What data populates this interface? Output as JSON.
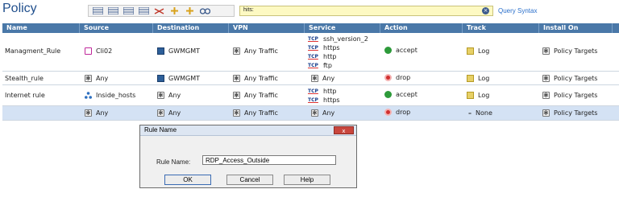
{
  "page_title": "Policy",
  "search": {
    "value": "hits:",
    "clear_icon": "clear-icon"
  },
  "query_syntax": "Query Syntax",
  "columns": [
    "Name",
    "Source",
    "Destination",
    "VPN",
    "Service",
    "Action",
    "Track",
    "Install On"
  ],
  "rows": [
    {
      "name": "Managment_Rule",
      "source": "Cli02",
      "destination": "GWMGMT",
      "vpn": "Any Traffic",
      "services": [
        {
          "proto": "TCP",
          "name": "ssh_version_2"
        },
        {
          "proto": "TCP",
          "name": "https"
        },
        {
          "proto": "TCP",
          "name": "http"
        },
        {
          "proto": "TCP",
          "name": "ftp"
        }
      ],
      "action": "accept",
      "track": "Log",
      "install_on": "Policy Targets"
    },
    {
      "name": "Stealth_rule",
      "source": "Any",
      "destination": "GWMGMT",
      "vpn": "Any Traffic",
      "services": [
        {
          "proto": "",
          "name": "Any"
        }
      ],
      "action": "drop",
      "track": "Log",
      "install_on": "Policy Targets"
    },
    {
      "name": "Internet rule",
      "source": "Inside_hosts",
      "destination": "Any",
      "vpn": "Any Traffic",
      "services": [
        {
          "proto": "TCP",
          "name": "http"
        },
        {
          "proto": "TCP",
          "name": "https"
        }
      ],
      "action": "accept",
      "track": "Log",
      "install_on": "Policy Targets"
    },
    {
      "name": "",
      "source": "Any",
      "destination": "Any",
      "vpn": "Any Traffic",
      "services": [
        {
          "proto": "",
          "name": "Any"
        }
      ],
      "action": "drop",
      "track": "None",
      "install_on": "Policy Targets"
    }
  ],
  "dialog": {
    "title": "Rule Name",
    "close": "x",
    "field_label": "Rule Name:",
    "field_value": "RDP_Access_Outside",
    "ok": "OK",
    "cancel": "Cancel",
    "help": "Help"
  },
  "colors": {
    "header": "#4a78a8",
    "selected_row": "#d4e2f4",
    "search_bg": "#fdf9c2",
    "accept": "#2d9a3a",
    "drop": "#d03030"
  }
}
